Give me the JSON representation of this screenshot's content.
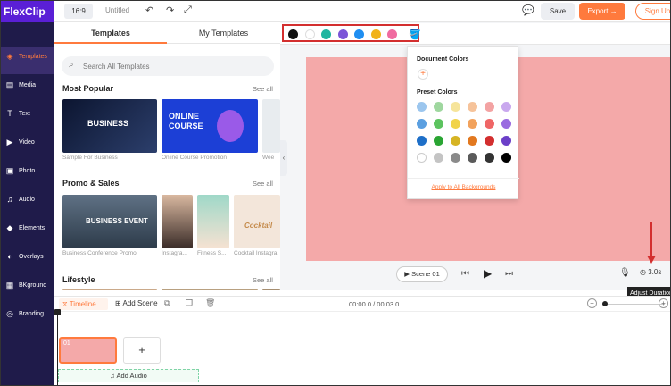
{
  "app": {
    "logo": "FlexClip"
  },
  "rail": {
    "items": [
      {
        "label": "Templates",
        "icon": "templates-icon",
        "glyph": "◈",
        "active": true
      },
      {
        "label": "Media",
        "icon": "media-icon",
        "glyph": "▤"
      },
      {
        "label": "Text",
        "icon": "text-icon",
        "glyph": "T"
      },
      {
        "label": "Video",
        "icon": "video-icon",
        "glyph": "▶"
      },
      {
        "label": "Photo",
        "icon": "photo-icon",
        "glyph": "▣"
      },
      {
        "label": "Audio",
        "icon": "audio-icon",
        "glyph": "♫"
      },
      {
        "label": "Elements",
        "icon": "elements-icon",
        "glyph": "◆"
      },
      {
        "label": "Overlays",
        "icon": "overlays-icon",
        "glyph": "◐"
      },
      {
        "label": "BKground",
        "icon": "background-icon",
        "glyph": "▦"
      },
      {
        "label": "Branding",
        "icon": "branding-icon",
        "glyph": "◎"
      }
    ]
  },
  "topbar": {
    "ratio": "16:9",
    "title": "Untitled",
    "save": "Save",
    "export": "Export →",
    "signup": "Sign Up"
  },
  "panel": {
    "tabs": [
      "Templates",
      "My Templates"
    ],
    "search_placeholder": "Search All Templates",
    "sections": [
      {
        "title": "Most Popular",
        "see_all": "See all",
        "captions": [
          "Sample For Business",
          "Online Course Promotion",
          "Wee"
        ]
      },
      {
        "title": "Promo & Sales",
        "see_all": "See all",
        "captions": [
          "Business Conference Promo",
          "Instagra...",
          "Fitness S...",
          "Cocktail Instagra"
        ]
      },
      {
        "title": "Lifestyle",
        "see_all": "See all"
      }
    ],
    "thumb_texts": {
      "business": "BUSINESS",
      "online": "ONLINE",
      "course": "COURSE",
      "event": "BUSINESS EVENT",
      "cocktail": "Cocktail"
    }
  },
  "toolbar": {
    "colors": [
      "#111111",
      "#ffffff",
      "#1fb5a0",
      "#7b55d8",
      "#1f8ef1",
      "#f1b21a",
      "#f06ba0"
    ]
  },
  "popup": {
    "document_colors": "Document Colors",
    "preset_colors": "Preset Colors",
    "apply_all": "Apply to All Backgrounds",
    "swatches": [
      [
        "#9cc6ee",
        "#9fd79f",
        "#f6e49a",
        "#f6c39a",
        "#f3a3a3",
        "#c9a8ee"
      ],
      [
        "#5b9fe0",
        "#5cc35f",
        "#f1d34b",
        "#f2a25c",
        "#ef6666",
        "#9a6be0"
      ],
      [
        "#1e6fc8",
        "#2aa533",
        "#d6b424",
        "#e2781f",
        "#d32f2f",
        "#6b3fc8"
      ],
      [
        "#ffffff",
        "#c4c4c4",
        "#8a8a8a",
        "#5a5a5a",
        "#333333",
        "#000000"
      ]
    ]
  },
  "player": {
    "scene": "Scene 01",
    "duration": "3.0s",
    "tooltip": "Adjust Duration"
  },
  "timeline": {
    "label": "Timeline",
    "add_scene": "Add Scene",
    "time": "00:00.0 / 00:03.0",
    "clip_label": "01",
    "add_audio": "Add Audio"
  },
  "accent": "#ff7a3d"
}
